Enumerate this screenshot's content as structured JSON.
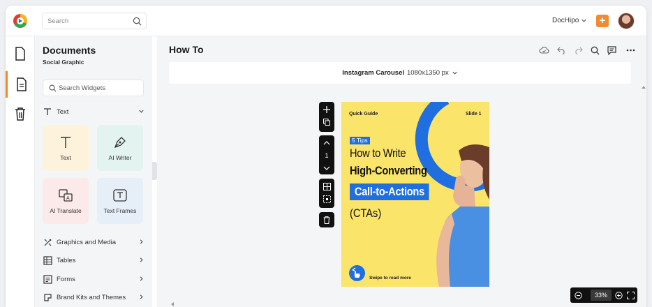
{
  "topbar": {
    "search_placeholder": "Search",
    "account_label": "DocHipo",
    "plus_label": "+"
  },
  "panel": {
    "title": "Documents",
    "subtitle": "Social Graphic",
    "widget_search_placeholder": "Search Widgets",
    "text_section": "Text",
    "tiles": [
      {
        "label": "Text",
        "color": "#fdf3dc"
      },
      {
        "label": "AI Writer",
        "color": "#e3f3f0"
      },
      {
        "label": "AI Translate",
        "color": "#fce9e9"
      },
      {
        "label": "Text Frames",
        "color": "#e6eef8"
      }
    ],
    "sections": [
      {
        "label": "Graphics and Media",
        "icon": "graphics-icon"
      },
      {
        "label": "Tables",
        "icon": "table-icon"
      },
      {
        "label": "Forms",
        "icon": "form-icon"
      },
      {
        "label": "Brand Kits and Themes",
        "icon": "brand-kit-icon"
      }
    ]
  },
  "main": {
    "doc_title": "How To",
    "size_name": "Instagram Carousel",
    "size_dims": "1080x1350 px",
    "page_number": "1"
  },
  "canvas": {
    "label_left": "Quick Guide",
    "label_right": "Slide 1",
    "tips": "5 Tips",
    "line1": "How to Write",
    "line2": "High-Converting",
    "line3": "Call-to-Actions",
    "line4": "(CTAs)",
    "swipe": "Swipe to read more",
    "bg_color": "#fbe46a",
    "accent_color": "#1f6fe0"
  },
  "zoom": {
    "percent": "33%"
  },
  "colors": {
    "brand_orange": "#f28b30",
    "canvas_yellow": "#fbe46a",
    "accent_blue": "#1f6fe0"
  }
}
